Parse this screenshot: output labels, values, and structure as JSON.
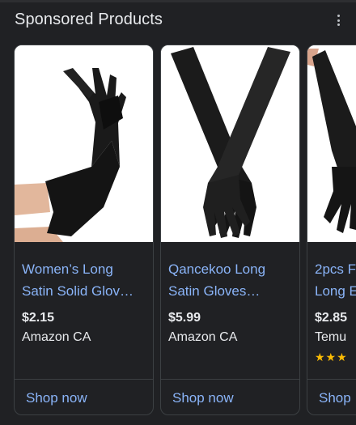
{
  "section": {
    "title": "Sponsored Products",
    "more_icon": "more-vert-icon"
  },
  "products": [
    {
      "title_line1": "Women’s Long",
      "title_line2": "Satin Solid Glov…",
      "price": "$2.15",
      "merchant": "Amazon CA",
      "cta": "Shop now"
    },
    {
      "title_line1": "Qancekoo Long",
      "title_line2": "Satin Gloves…",
      "price": "$5.99",
      "merchant": "Amazon CA",
      "cta": "Shop now"
    },
    {
      "title_line1": "2pcs F",
      "title_line2": "Long E",
      "price": "$2.85",
      "merchant": "Temu",
      "rating_stars": "★★★",
      "cta": "Shop"
    }
  ],
  "colors": {
    "background": "#202124",
    "link": "#8ab4f8",
    "star": "#fbbc04"
  }
}
